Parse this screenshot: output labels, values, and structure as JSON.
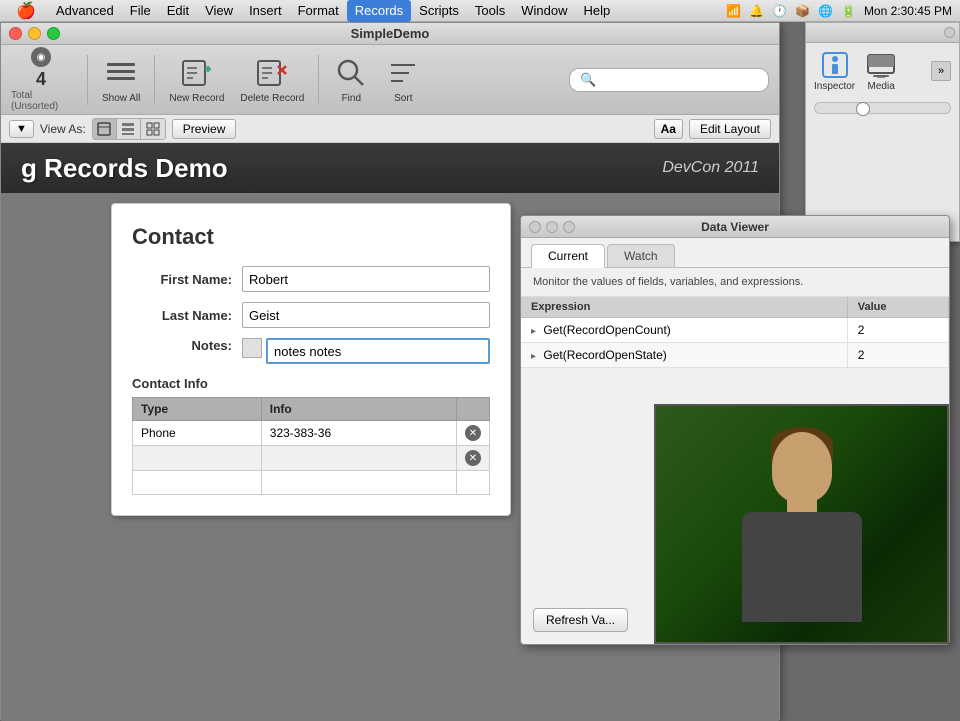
{
  "menubar": {
    "apple": "🍎",
    "items": [
      {
        "label": "Advanced"
      },
      {
        "label": "File"
      },
      {
        "label": "Edit"
      },
      {
        "label": "View"
      },
      {
        "label": "Insert"
      },
      {
        "label": "Format"
      },
      {
        "label": "Records"
      },
      {
        "label": "Scripts"
      },
      {
        "label": "Tools"
      },
      {
        "label": "Window"
      },
      {
        "label": "Help"
      }
    ],
    "time": "Mon 2:30:45 PM",
    "active_item": "Records"
  },
  "window": {
    "title": "SimpleDemo"
  },
  "toolbar": {
    "record_number": "4",
    "record_total": "Total (Unsorted)",
    "show_all_label": "Show All",
    "new_record_label": "New Record",
    "delete_record_label": "Delete Record",
    "find_label": "Find",
    "sort_label": "Sort",
    "search_placeholder": "🔍"
  },
  "viewbar": {
    "view_as_label": "View As:",
    "preview_label": "Preview",
    "aa_label": "Aa",
    "edit_layout_label": "Edit Layout"
  },
  "content": {
    "title": "g Records Demo",
    "subtitle": "DevCon 2011"
  },
  "contact_form": {
    "title": "Contact",
    "first_name_label": "First Name:",
    "first_name_value": "Robert",
    "last_name_label": "Last Name:",
    "last_name_value": "Geist",
    "notes_label": "Notes:",
    "notes_value": "notes notes",
    "section_title": "Contact Info",
    "table": {
      "headers": [
        "Type",
        "Info"
      ],
      "rows": [
        {
          "type": "Phone",
          "info": "323-383-36"
        },
        {
          "type": "",
          "info": ""
        },
        {
          "type": "",
          "info": ""
        }
      ]
    }
  },
  "inspector": {
    "title": "",
    "inspector_label": "Inspector",
    "media_label": "Media"
  },
  "data_viewer": {
    "title": "Data Viewer",
    "tab_current": "Current",
    "tab_watch": "Watch",
    "description": "Monitor the values of fields, variables, and expressions.",
    "table": {
      "headers": [
        "Expression",
        "Value"
      ],
      "rows": [
        {
          "expression": "Get(RecordOpenCount)",
          "value": "2"
        },
        {
          "expression": "Get(RecordOpenState)",
          "value": "2"
        }
      ]
    },
    "refresh_label": "Refresh Va..."
  }
}
